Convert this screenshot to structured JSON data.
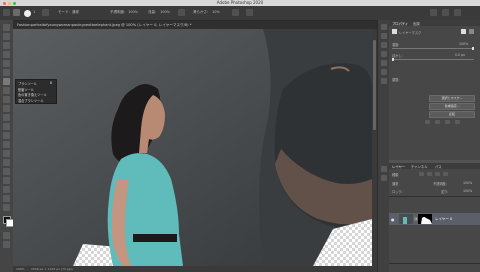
{
  "app": {
    "window_title": "Adobe Photoshop 2020",
    "traffic_lights": [
      "#ff5f57",
      "#febc2e",
      "#28c840"
    ]
  },
  "options_bar": {
    "brush_size": "1",
    "mode_label": "モード:",
    "mode_value": "通常",
    "opacity_label": "不透明度:",
    "opacity_value": "100%",
    "flow_label": "流量:",
    "flow_value": "100%",
    "smoothing_label": "滑らかさ:",
    "smoothing_value": "10%"
  },
  "document": {
    "tab_title": "Fashionportraitofyoungwomanposingnexttoelephant.jpeg @ 100% (レイヤー 0, レイヤーマスク/8) *",
    "status_zoom": "100%",
    "status_info": "1500 px × 1125 px (72 ppi)"
  },
  "context_menu": {
    "items": [
      "ブラシツール",
      "鉛筆ツール",
      "色の置き換えツール",
      "混合ブラシツール"
    ],
    "shortcut": "B"
  },
  "properties_panel": {
    "tab_properties": "プロパティ",
    "tab_other": "色調",
    "mask_label": "レイヤーマスク",
    "density_label": "濃度:",
    "density_value": "100%",
    "feather_label": "ぼかし:",
    "feather_value": "0.0 px",
    "refine_label": "調整:",
    "select_mask_button": "選択とマスク...",
    "color_range_button": "色域指定...",
    "invert_button": "反転"
  },
  "layers_panel": {
    "tabs": [
      "レイヤー",
      "チャンネル",
      "パス"
    ],
    "kind_label": "種類",
    "blend_mode": "通常",
    "opacity_label": "不透明度:",
    "opacity_value": "100%",
    "lock_label": "ロック:",
    "fill_label": "塗り:",
    "fill_value": "100%",
    "layers": [
      {
        "name": "レイヤー 0"
      }
    ]
  },
  "icons": {
    "mask_thumb": "layer-mask-icon",
    "link": "link-icon",
    "eye": "eye-icon"
  }
}
